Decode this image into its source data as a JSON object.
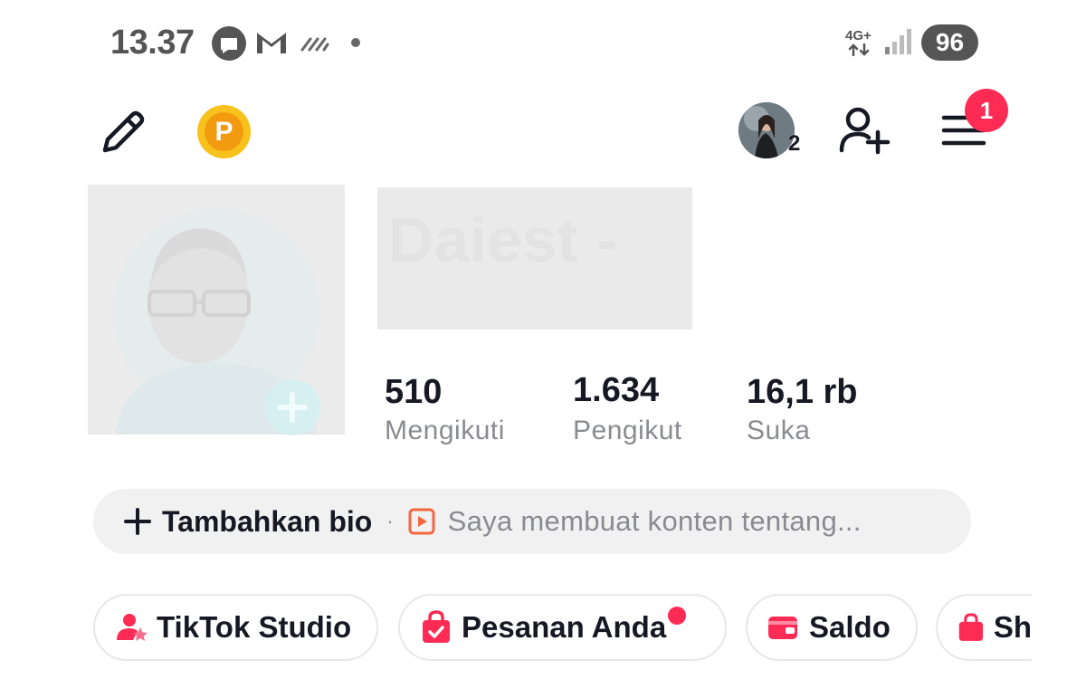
{
  "status_bar": {
    "time": "13.37",
    "network": "4G+",
    "battery": "96",
    "notif_icons": [
      "camera-app-icon",
      "gmail-icon",
      "sync-icon",
      "more-dot-icon"
    ]
  },
  "top_bar": {
    "icons": [
      "edit-pencil-icon",
      "points-coin-icon",
      "account-switch-avatar",
      "add-friend-icon",
      "menu-icon"
    ],
    "points_letter": "P",
    "account_count": "2",
    "menu_badge": "1"
  },
  "profile": {
    "name": "Daiest -",
    "stats": [
      {
        "value": "510",
        "label": "Mengikuti"
      },
      {
        "value": "1.634",
        "label": "Pengikut"
      },
      {
        "value": "16,1 rb",
        "label": "Suka"
      }
    ]
  },
  "bio": {
    "add_label": "Tambahkan bio",
    "separator": "·",
    "suggestion": "Saya membuat konten tentang..."
  },
  "shortcuts": [
    {
      "label": "TikTok Studio",
      "icon": "studio-icon"
    },
    {
      "label": "Pesanan Anda",
      "icon": "orders-bag-icon",
      "has_dot": true
    },
    {
      "label": "Saldo",
      "icon": "wallet-icon"
    },
    {
      "label": "Sh",
      "icon": "shop-bag-icon"
    }
  ],
  "colors": {
    "accent": "#fe2c55",
    "coin": "#f7c21b",
    "text": "#161823",
    "muted": "#8a8b91"
  }
}
